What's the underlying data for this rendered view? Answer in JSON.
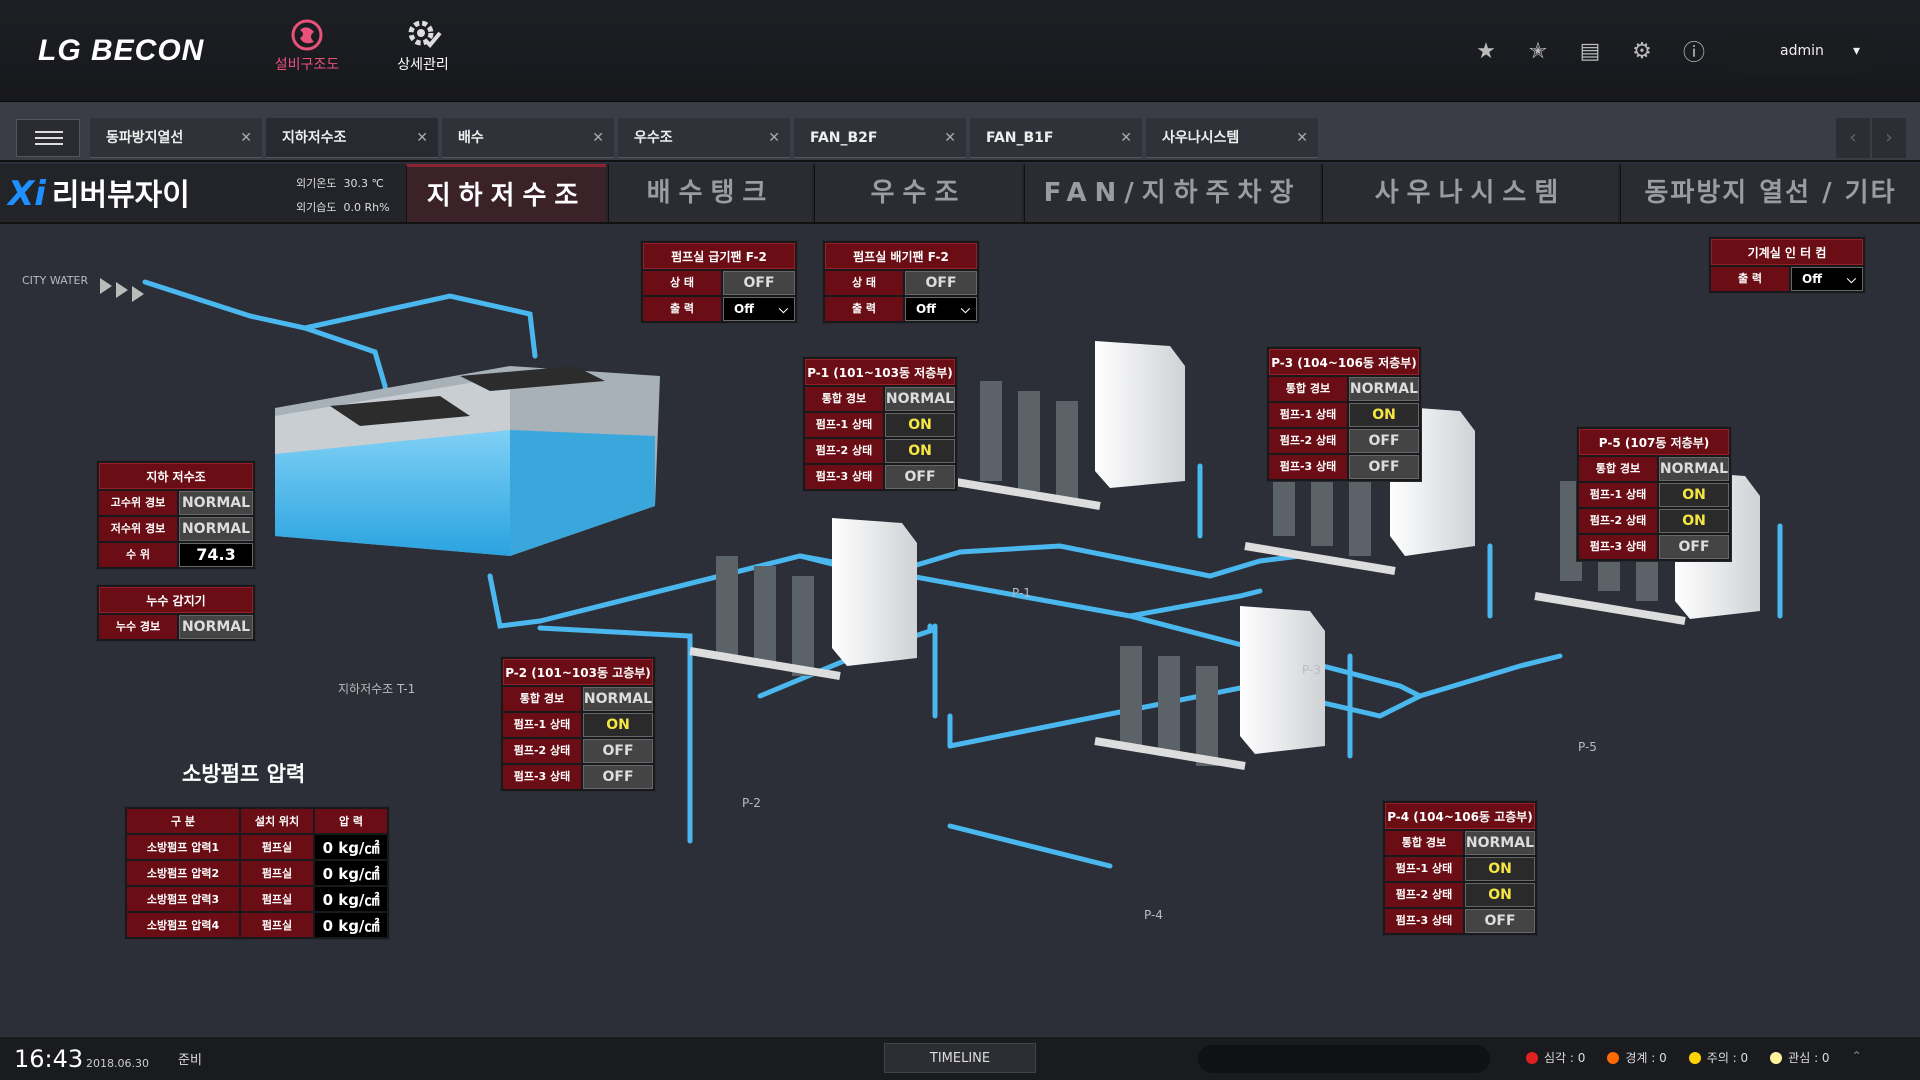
{
  "header": {
    "brand": "LG BECON",
    "nav": [
      {
        "label": "설비구조도",
        "icon": "equipment-diagram-icon",
        "active": true
      },
      {
        "label": "상세관리",
        "icon": "detail-settings-icon",
        "active": false
      }
    ],
    "user": "admin"
  },
  "tabs": [
    {
      "label": "동파방지열선"
    },
    {
      "label": "지하저수조",
      "active": true
    },
    {
      "label": "배수"
    },
    {
      "label": "우수조"
    },
    {
      "label": "FAN_B2F"
    },
    {
      "label": "FAN_B1F"
    },
    {
      "label": "사우나시스템"
    }
  ],
  "site": {
    "name": "리버뷰자이",
    "outdoor_temp_label": "외기온도",
    "outdoor_temp": "30.3 ℃",
    "outdoor_humidity_label": "외기습도",
    "outdoor_humidity": "0.0 Rh%"
  },
  "system_tabs": [
    "지하저수조",
    "배수탱크",
    "우수조",
    "FAN/지하주차장",
    "사우나시스템",
    "동파방지 열선 / 기타"
  ],
  "labels": {
    "city_water": "CITY WATER",
    "tank": "지하저수조 T-1",
    "p1": "P-1",
    "p2": "P-2",
    "p3": "P-3",
    "p4": "P-4",
    "p5": "P-5"
  },
  "fan_supply": {
    "title": "펌프실 급기팬 F-2",
    "state_label": "상 태",
    "state": "OFF",
    "output_label": "출 력",
    "output": "Off"
  },
  "fan_exhaust": {
    "title": "펌프실 배기팬 F-2",
    "state_label": "상 태",
    "state": "OFF",
    "output_label": "출 력",
    "output": "Off"
  },
  "intercom": {
    "title": "기계실 인 터 컴",
    "output_label": "출 력",
    "output": "Off"
  },
  "tank_panel": {
    "title": "지하 저수조",
    "high_label": "고수위 경보",
    "high": "NORMAL",
    "low_label": "저수위 경보",
    "low": "NORMAL",
    "level_label": "수 위",
    "level": "74.3"
  },
  "leak_panel": {
    "title": "누수 감지기",
    "alarm_label": "누수 경보",
    "alarm": "NORMAL"
  },
  "pumps": {
    "p1": {
      "title": "P-1 (101~103동 저층부)",
      "alarm": "NORMAL",
      "s1": "ON",
      "s2": "ON",
      "s3": "OFF"
    },
    "p2": {
      "title": "P-2 (101~103동 고층부)",
      "alarm": "NORMAL",
      "s1": "ON",
      "s2": "OFF",
      "s3": "OFF"
    },
    "p3": {
      "title": "P-3 (104~106동 저층부)",
      "alarm": "NORMAL",
      "s1": "ON",
      "s2": "OFF",
      "s3": "OFF"
    },
    "p4": {
      "title": "P-4 (104~106동 고층부)",
      "alarm": "NORMAL",
      "s1": "ON",
      "s2": "ON",
      "s3": "OFF"
    },
    "p5": {
      "title": "P-5 (107동 저층부)",
      "alarm": "NORMAL",
      "s1": "ON",
      "s2": "ON",
      "s3": "OFF"
    }
  },
  "pump_labels": {
    "alarm": "통합 경보",
    "s1": "펌프-1 상태",
    "s2": "펌프-2 상태",
    "s3": "펌프-3 상태"
  },
  "fire": {
    "title": "소방펌프 압력",
    "headers": [
      "구 분",
      "설치 위치",
      "압 력"
    ],
    "rows": [
      {
        "name": "소방펌프 압력1",
        "loc": "펌프실",
        "val": "0 kg/㎠"
      },
      {
        "name": "소방펌프 압력2",
        "loc": "펌프실",
        "val": "0 kg/㎠"
      },
      {
        "name": "소방펌프 압력3",
        "loc": "펌프실",
        "val": "0 kg/㎠"
      },
      {
        "name": "소방펌프 압력4",
        "loc": "펌프실",
        "val": "0 kg/㎠"
      }
    ]
  },
  "status": {
    "time": "16:43",
    "date": "2018.06.30",
    "state": "준비",
    "timeline": "TIMELINE",
    "alarms": [
      {
        "label": "심각 : 0",
        "color": "#e02020"
      },
      {
        "label": "경계 : 0",
        "color": "#ff6a00"
      },
      {
        "label": "주의 : 0",
        "color": "#ffd400"
      },
      {
        "label": "관심 : 0",
        "color": "#fff3a0"
      }
    ]
  }
}
